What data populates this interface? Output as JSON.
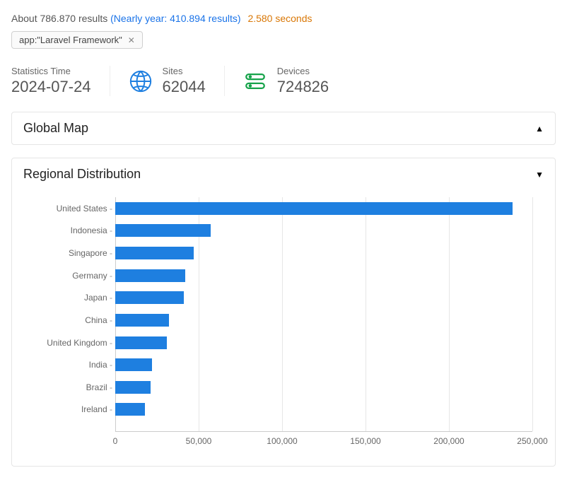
{
  "results": {
    "about_prefix": "About",
    "total": "786.870",
    "results_word": "results",
    "nearly_prefix": "(Nearly year:",
    "nearly_value": "410.894",
    "nearly_suffix": "results)",
    "elapsed": "2.580 seconds"
  },
  "filter_chip": {
    "label": "app:\"Laravel Framework\""
  },
  "stats": {
    "time_label": "Statistics Time",
    "time_value": "2024-07-24",
    "sites_label": "Sites",
    "sites_value": "62044",
    "devices_label": "Devices",
    "devices_value": "724826"
  },
  "panels": {
    "global_map_title": "Global Map",
    "regional_title": "Regional Distribution"
  },
  "chart_data": {
    "type": "bar",
    "orientation": "horizontal",
    "title": "Regional Distribution",
    "xlabel": "",
    "ylabel": "",
    "xlim": [
      0,
      250000
    ],
    "xticks": [
      0,
      50000,
      100000,
      150000,
      200000,
      250000
    ],
    "xtick_labels": [
      "0",
      "50,000",
      "100,000",
      "150,000",
      "200,000",
      "250,000"
    ],
    "categories": [
      "United States",
      "Indonesia",
      "Singapore",
      "Germany",
      "Japan",
      "China",
      "United Kingdom",
      "India",
      "Brazil",
      "Ireland"
    ],
    "values": [
      238000,
      57000,
      47000,
      42000,
      41000,
      32000,
      31000,
      22000,
      21000,
      18000
    ],
    "bar_color": "#1e7fe0"
  }
}
